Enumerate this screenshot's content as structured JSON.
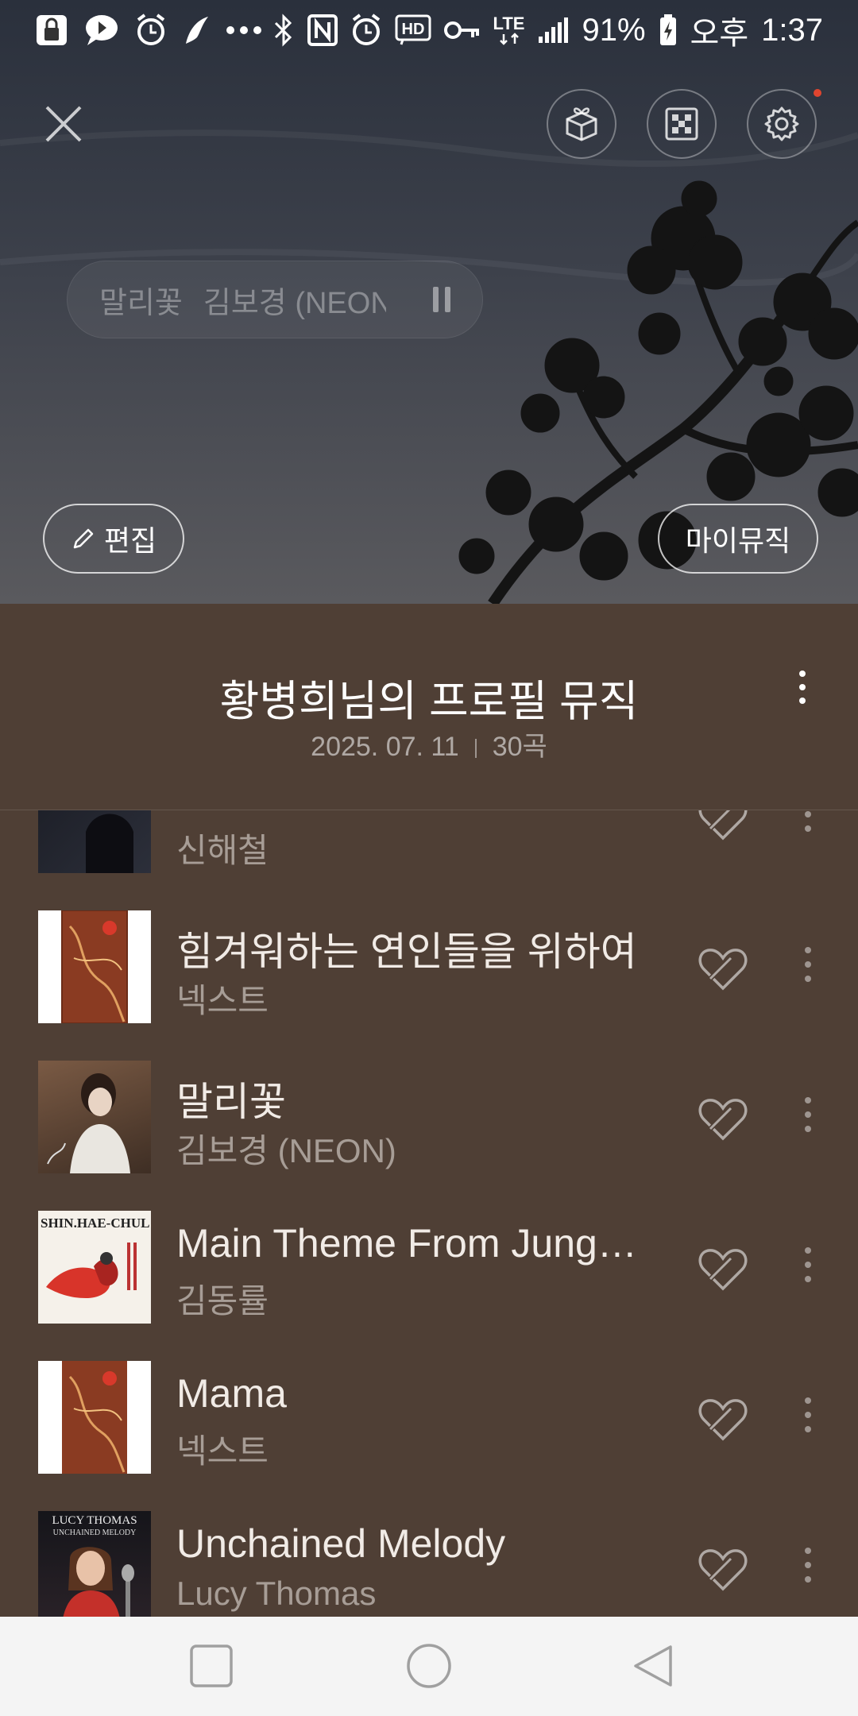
{
  "status_bar": {
    "battery": "91%",
    "time_prefix": "오후",
    "time": "1:37",
    "network": "LTE",
    "icons": [
      "lock-icon",
      "message-icon",
      "alarm-icon",
      "bird-icon",
      "more-dots-icon",
      "bluetooth-icon",
      "nfc-icon",
      "alarm-clock-icon",
      "hd-icon",
      "key-icon",
      "lte-icon",
      "signal-icon",
      "battery-icon"
    ]
  },
  "header": {
    "icons": [
      "close-icon",
      "gift-box-icon",
      "pattern-icon",
      "settings-icon"
    ],
    "edit_label": "편집",
    "mymusic_label": "마이뮤직"
  },
  "mini_player": {
    "title": "말리꽃",
    "artist": "김보경 (NEON)"
  },
  "playlist": {
    "title": "황병희님의 프로필 뮤직",
    "date": "2025. 07. 11",
    "count": "30곡"
  },
  "songs": [
    {
      "title": "",
      "artist": "신해철"
    },
    {
      "title": "힘겨워하는 연인들을 위하여",
      "artist": "넥스트"
    },
    {
      "title": "말리꽃",
      "artist": "김보경 (NEON)"
    },
    {
      "title": "Main Theme From Jungle Story",
      "artist": "김동률"
    },
    {
      "title": "Mama",
      "artist": "넥스트"
    },
    {
      "title": "Unchained Melody",
      "artist": "Lucy Thomas"
    }
  ],
  "album_art_text": {
    "shin": "SHIN.HAE-CHUL",
    "lucy_line1": "LUCY THOMAS",
    "lucy_line2": "UNCHAINED MELODY"
  },
  "nav": {
    "icons": [
      "recent-apps-icon",
      "home-icon",
      "back-icon"
    ]
  },
  "colors": {
    "panel": "#4f3f35",
    "accent_red": "#e0452f"
  }
}
